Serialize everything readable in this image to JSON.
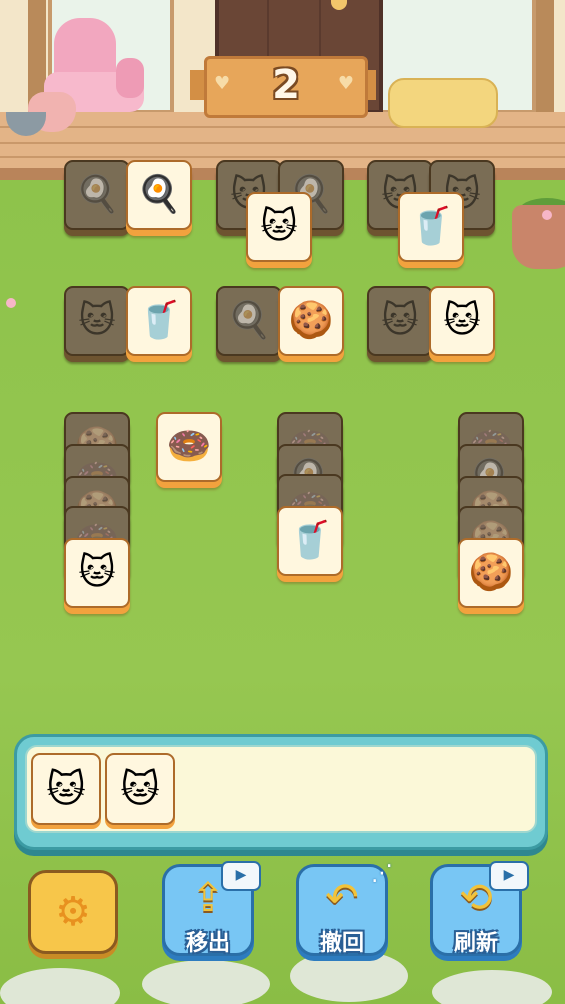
{
  "level": {
    "number": "2"
  },
  "icons": {
    "egg": "🍳",
    "cat_camera": "🐱",
    "cup": "🥤",
    "donut": "🍩",
    "cookie": "🍪",
    "settings": "⚙",
    "move_out": "⇪",
    "undo": "↶",
    "refresh": "⟲",
    "video": "▶",
    "share": "⋰"
  },
  "board": {
    "tiles": [
      {
        "item": "egg",
        "blocked": true
      },
      {
        "item": "egg",
        "blocked": false
      },
      {
        "item": "cat_camera",
        "blocked": true
      },
      {
        "item": "egg",
        "blocked": true
      },
      {
        "item": "cat_camera",
        "blocked": false
      },
      {
        "item": "cat_camera",
        "blocked": true
      },
      {
        "item": "cat_camera",
        "blocked": true
      },
      {
        "item": "cup",
        "blocked": false
      },
      {
        "item": "cat_camera",
        "blocked": true
      },
      {
        "item": "cup",
        "blocked": false
      },
      {
        "item": "egg",
        "blocked": true
      },
      {
        "item": "cookie",
        "blocked": false
      },
      {
        "item": "cat_camera",
        "blocked": true
      },
      {
        "item": "cat_camera",
        "blocked": false
      },
      {
        "item": "cookie",
        "blocked": true
      },
      {
        "item": "donut",
        "blocked": true
      },
      {
        "item": "cookie",
        "blocked": true
      },
      {
        "item": "donut",
        "blocked": true
      },
      {
        "item": "cat_camera",
        "blocked": false
      },
      {
        "item": "donut",
        "blocked": false
      },
      {
        "item": "donut",
        "blocked": true
      },
      {
        "item": "egg",
        "blocked": true
      },
      {
        "item": "donut",
        "blocked": true
      },
      {
        "item": "cup",
        "blocked": false
      },
      {
        "item": "donut",
        "blocked": true
      },
      {
        "item": "egg",
        "blocked": true
      },
      {
        "item": "cookie",
        "blocked": true
      },
      {
        "item": "cookie",
        "blocked": true
      },
      {
        "item": "cookie",
        "blocked": false
      }
    ]
  },
  "tray": {
    "slots": [
      "cat_camera",
      "cat_camera"
    ]
  },
  "buttons": {
    "settings": {
      "icon": "settings"
    },
    "move_out": {
      "label": "移出",
      "icon": "move_out",
      "badge": "video"
    },
    "undo": {
      "label": "撤回",
      "icon": "undo",
      "badge": "share"
    },
    "refresh": {
      "label": "刷新",
      "icon": "refresh",
      "badge": "video"
    }
  }
}
